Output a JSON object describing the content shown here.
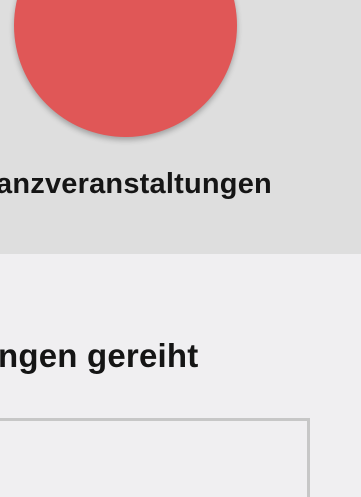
{
  "header": {
    "category_title": "anzveranstaltungen"
  },
  "main": {
    "section_heading": "ngen gereiht"
  },
  "colors": {
    "badge": "#e05757",
    "header_background": "#dedede",
    "page_background": "#f0eff1"
  }
}
